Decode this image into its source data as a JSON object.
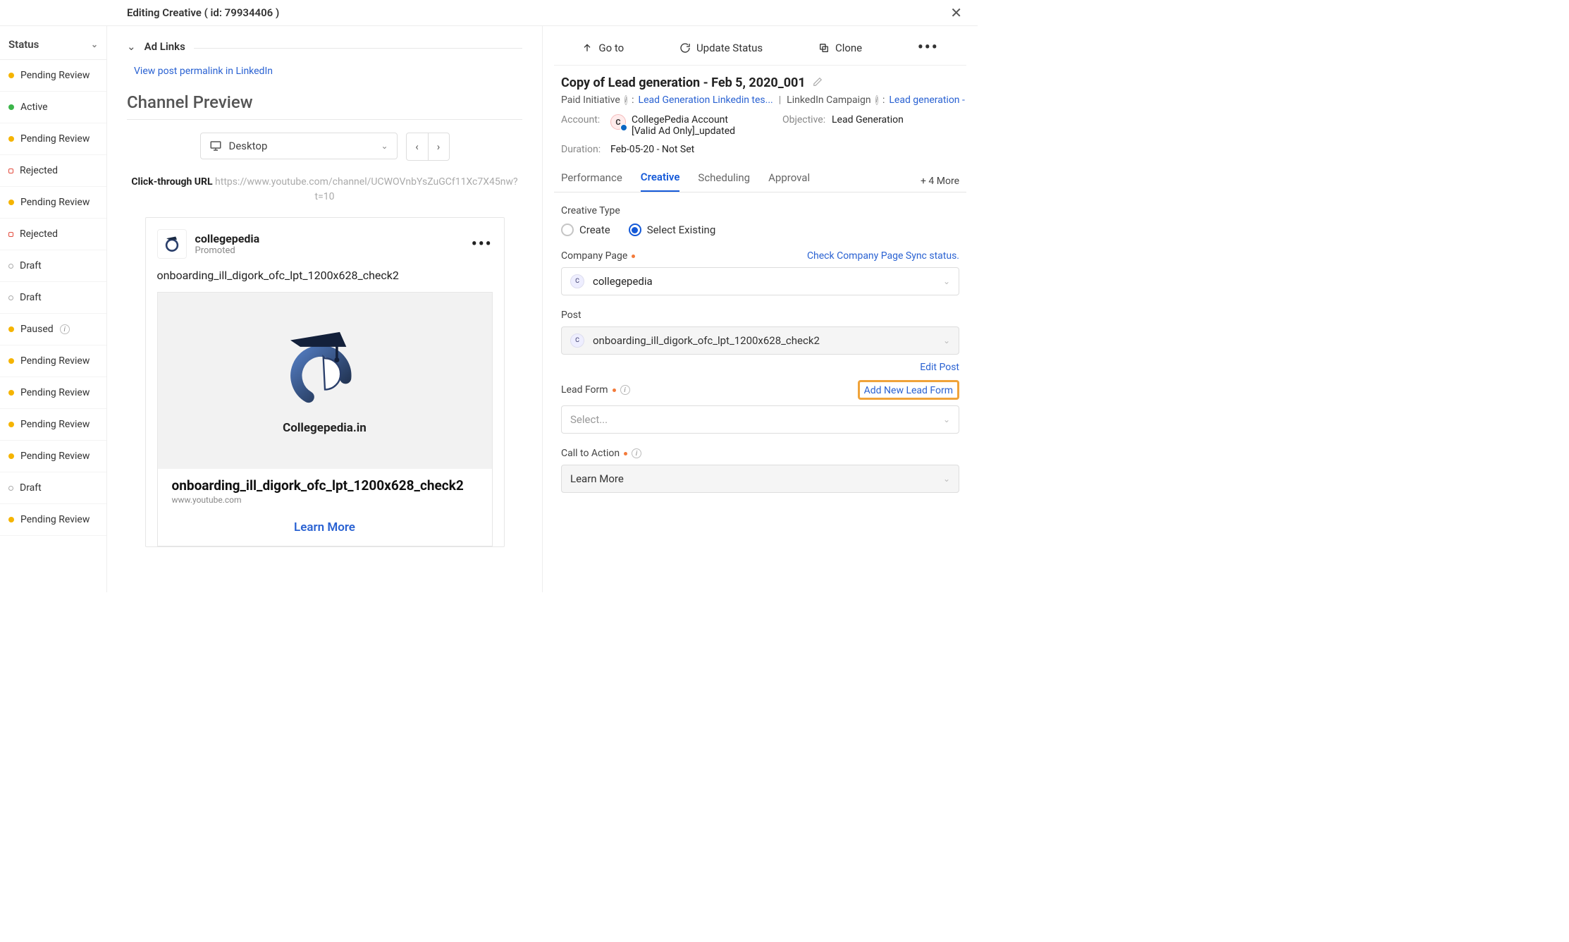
{
  "header": {
    "title": "Editing Creative ( id: 79934406 )"
  },
  "sidebar": {
    "column": "Status",
    "items": [
      {
        "dot": "orange",
        "label": "Pending Review"
      },
      {
        "dot": "green",
        "label": "Active"
      },
      {
        "dot": "orange",
        "label": "Pending Review"
      },
      {
        "dot": "red",
        "label": "Rejected"
      },
      {
        "dot": "orange",
        "label": "Pending Review"
      },
      {
        "dot": "red",
        "label": "Rejected"
      },
      {
        "dot": "none",
        "label": "Draft"
      },
      {
        "dot": "none",
        "label": "Draft"
      },
      {
        "dot": "orange",
        "label": "Paused",
        "info": true
      },
      {
        "dot": "orange",
        "label": "Pending Review"
      },
      {
        "dot": "orange",
        "label": "Pending Review"
      },
      {
        "dot": "orange",
        "label": "Pending Review"
      },
      {
        "dot": "orange",
        "label": "Pending Review"
      },
      {
        "dot": "none",
        "label": "Draft"
      },
      {
        "dot": "orange",
        "label": "Pending Review"
      }
    ]
  },
  "preview": {
    "adLinksLabel": "Ad Links",
    "permalink": "View post permalink in LinkedIn",
    "channelPreview": "Channel Preview",
    "device": "Desktop",
    "clickLabel": "Click-through URL",
    "clickUrl": "https://www.youtube.com/channel/UCWOVnbYsZuGCf11Xc7X45nw?t=10",
    "post": {
      "page": "collegepedia",
      "promoted": "Promoted",
      "text": "onboarding_ill_digork_ofc_lpt_1200x628_check2",
      "imageBrand": "Collegepedia.in",
      "title": "onboarding_ill_digork_ofc_lpt_1200x628_check2",
      "domain": "www.youtube.com",
      "cta": "Learn More"
    }
  },
  "edit": {
    "actions": {
      "goto": "Go to",
      "update": "Update Status",
      "clone": "Clone"
    },
    "title": "Copy of Lead generation - Feb 5, 2020_001",
    "crumbs": {
      "pi": "Paid Initiative",
      "piLink": "Lead Generation Linkedin tes...",
      "lc": "LinkedIn Campaign",
      "lcLink": "Lead generation - Fe..."
    },
    "meta": {
      "accountLabel": "Account:",
      "accountValue": "CollegePedia Account [Valid Ad Only]_updated",
      "objectiveLabel": "Objective:",
      "objectiveValue": "Lead Generation",
      "durationLabel": "Duration:",
      "durationValue": "Feb-05-20 - Not Set"
    },
    "tabs": [
      "Performance",
      "Creative",
      "Scheduling",
      "Approval"
    ],
    "tabsMore": "+ 4 More",
    "creativeType": {
      "label": "Creative Type",
      "create": "Create",
      "existing": "Select Existing"
    },
    "companyPage": {
      "label": "Company Page",
      "syncLink": "Check Company Page Sync status.",
      "value": "collegepedia"
    },
    "post": {
      "label": "Post",
      "value": "onboarding_ill_digork_ofc_lpt_1200x628_check2",
      "editLink": "Edit Post"
    },
    "leadForm": {
      "label": "Lead Form",
      "addLink": "Add New Lead Form",
      "placeholder": "Select..."
    },
    "cta": {
      "label": "Call to Action",
      "value": "Learn More"
    }
  }
}
